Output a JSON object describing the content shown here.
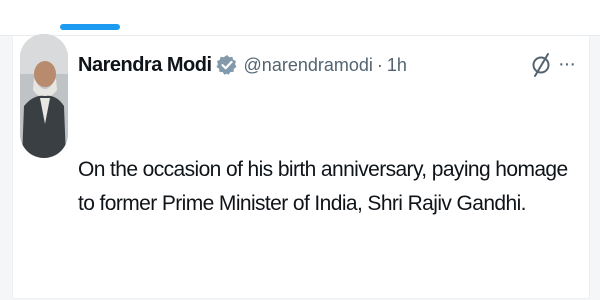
{
  "colors": {
    "accent": "#1d9bf0",
    "text": "#0f1419",
    "muted": "#536471",
    "verified": "#829aab"
  },
  "tweet": {
    "author_name": "Narendra Modi",
    "verified_icon": "verified-badge-icon",
    "handle": "@narendramodi",
    "separator": "·",
    "time": "1h",
    "text": "On the occasion of his birth anniversary, paying homage to former Prime Minister of India, Shri Rajiv Gandhi.",
    "grok_icon": "grok-icon",
    "more_icon": "more-options-icon",
    "more_glyph": "···"
  }
}
